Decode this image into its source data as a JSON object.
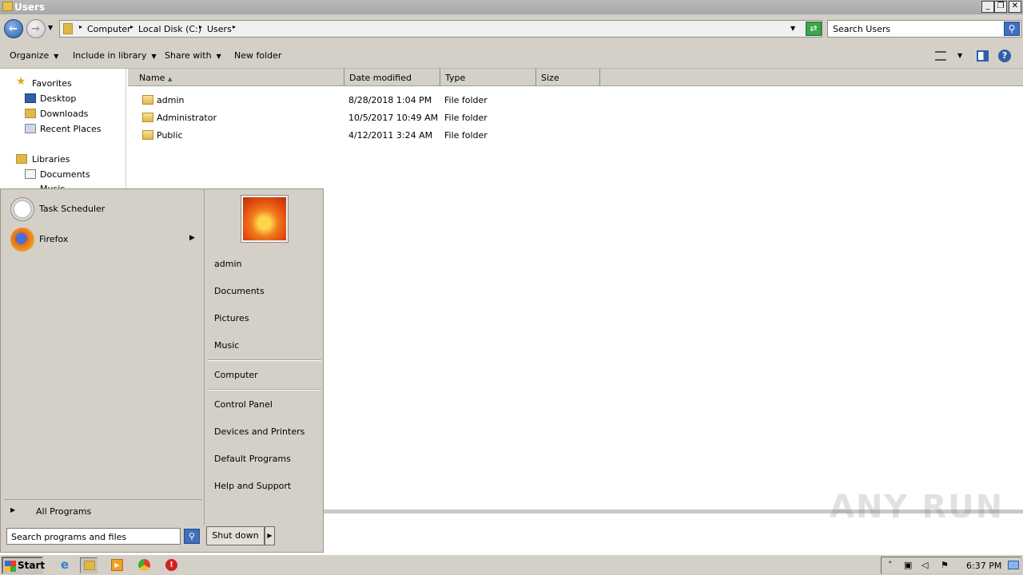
{
  "window": {
    "title": "Users",
    "minimize": "_",
    "restore": "❐",
    "close": "✕"
  },
  "address": {
    "crumbs": [
      "Computer",
      "Local Disk (C:)",
      "Users"
    ],
    "search_placeholder": "Search Users"
  },
  "toolbar": {
    "organize": "Organize",
    "include_in_library": "Include in library",
    "share_with": "Share with",
    "new_folder": "New folder",
    "help": "?"
  },
  "navpane": {
    "favorites": "Favorites",
    "desktop": "Desktop",
    "downloads": "Downloads",
    "recent_places": "Recent Places",
    "libraries": "Libraries",
    "documents": "Documents",
    "music_partial": "Music"
  },
  "filelist": {
    "columns": [
      "Name",
      "Date modified",
      "Type",
      "Size"
    ],
    "rows": [
      {
        "name": "admin",
        "date": "8/28/2018 1:04 PM",
        "type": "File folder"
      },
      {
        "name": "Administrator",
        "date": "10/5/2017 10:49 AM",
        "type": "File folder"
      },
      {
        "name": "Public",
        "date": "4/12/2011 3:24 AM",
        "type": "File folder"
      }
    ]
  },
  "startmenu": {
    "programs": [
      {
        "label": "Task Scheduler"
      },
      {
        "label": "Firefox"
      }
    ],
    "all_programs": "All Programs",
    "search_placeholder": "Search programs and files",
    "right_links": {
      "user": "admin",
      "documents": "Documents",
      "pictures": "Pictures",
      "music": "Music",
      "computer": "Computer",
      "control_panel": "Control Panel",
      "devices_printers": "Devices and Printers",
      "default_programs": "Default Programs",
      "help_support": "Help and Support"
    },
    "shutdown": "Shut down"
  },
  "taskbar": {
    "start": "Start",
    "clock": "6:37 PM"
  },
  "watermark": "ANY RUN",
  "colors": {
    "accent_blue": "#2f5fa8",
    "folder_yellow": "#e0b84a",
    "chrome_gray": "#d4d0c8"
  }
}
